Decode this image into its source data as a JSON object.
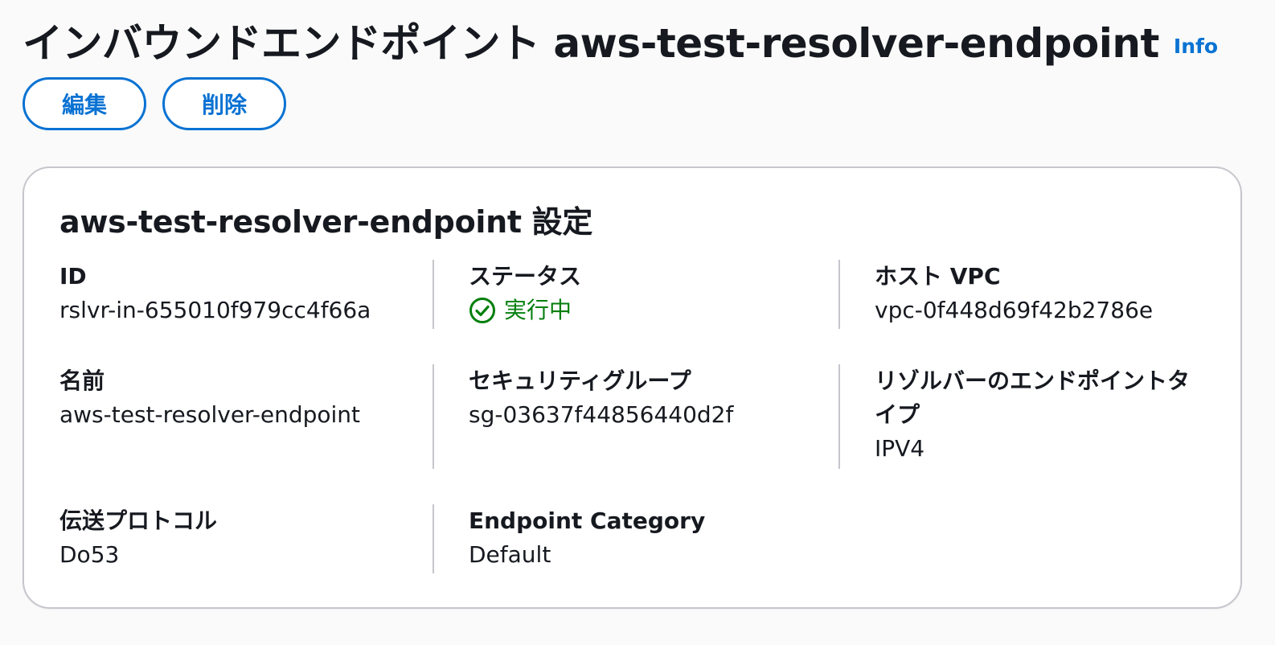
{
  "header": {
    "title": "インバウンドエンドポイント aws-test-resolver-endpoint",
    "info_label": "Info"
  },
  "actions": {
    "edit_label": "編集",
    "delete_label": "削除"
  },
  "settings": {
    "title": "aws-test-resolver-endpoint 設定",
    "fields": {
      "id": {
        "label": "ID",
        "value": "rslvr-in-655010f979cc4f66a"
      },
      "status": {
        "label": "ステータス",
        "value": "実行中",
        "icon": "status-success-icon",
        "color": "#037f0c"
      },
      "host_vpc": {
        "label": "ホスト VPC",
        "value": "vpc-0f448d69f42b2786e"
      },
      "name": {
        "label": "名前",
        "value": "aws-test-resolver-endpoint"
      },
      "security_group": {
        "label": "セキュリティグループ",
        "value": "sg-03637f44856440d2f"
      },
      "endpoint_type": {
        "label": "リゾルバーのエンドポイントタイプ",
        "value": "IPV4"
      },
      "protocol": {
        "label": "伝送プロトコル",
        "value": "Do53"
      },
      "endpoint_category": {
        "label": "Endpoint Category",
        "value": "Default"
      }
    }
  },
  "colors": {
    "accent": "#0972d3",
    "success": "#037f0c",
    "text": "#16191f",
    "border": "#c6c6cd",
    "background": "#fafafa"
  }
}
